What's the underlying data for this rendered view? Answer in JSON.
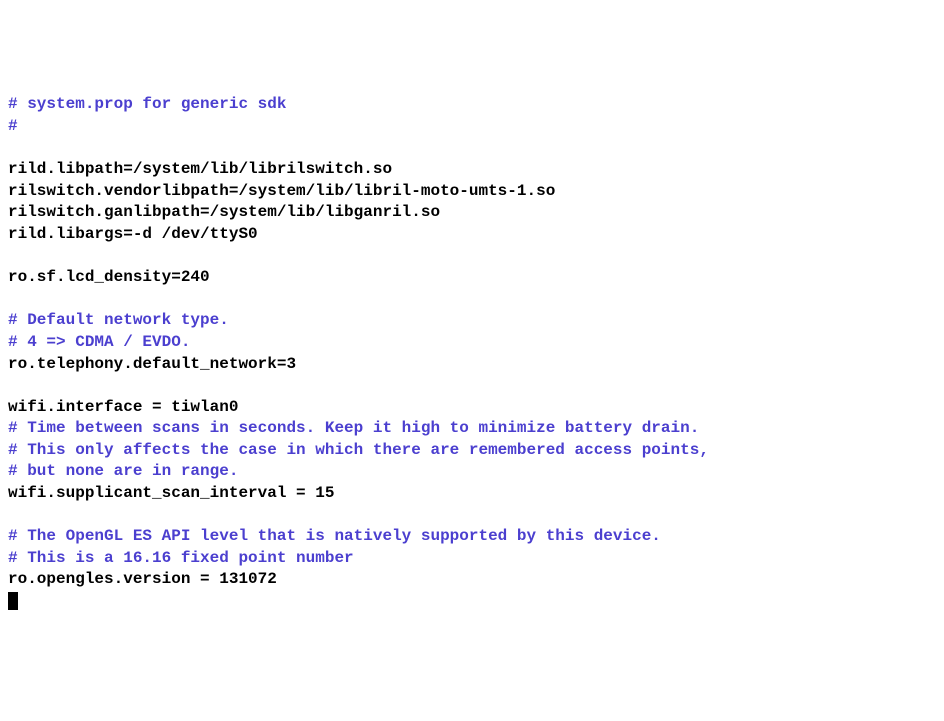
{
  "lines": [
    {
      "text": "# system.prop for generic sdk",
      "type": "comment"
    },
    {
      "text": "#",
      "type": "comment"
    },
    {
      "text": "",
      "type": "normal"
    },
    {
      "text": "rild.libpath=/system/lib/librilswitch.so",
      "type": "normal"
    },
    {
      "text": "rilswitch.vendorlibpath=/system/lib/libril-moto-umts-1.so",
      "type": "normal"
    },
    {
      "text": "rilswitch.ganlibpath=/system/lib/libganril.so",
      "type": "normal"
    },
    {
      "text": "rild.libargs=-d /dev/ttyS0",
      "type": "normal"
    },
    {
      "text": "",
      "type": "normal"
    },
    {
      "text": "ro.sf.lcd_density=240",
      "type": "normal"
    },
    {
      "text": "",
      "type": "normal"
    },
    {
      "text": "# Default network type.",
      "type": "comment"
    },
    {
      "text": "# 4 => CDMA / EVDO.",
      "type": "comment"
    },
    {
      "text": "ro.telephony.default_network=3",
      "type": "normal"
    },
    {
      "text": "",
      "type": "normal"
    },
    {
      "text": "wifi.interface = tiwlan0",
      "type": "normal"
    },
    {
      "text": "# Time between scans in seconds. Keep it high to minimize battery drain.",
      "type": "comment"
    },
    {
      "text": "# This only affects the case in which there are remembered access points,",
      "type": "comment"
    },
    {
      "text": "# but none are in range.",
      "type": "comment"
    },
    {
      "text": "wifi.supplicant_scan_interval = 15",
      "type": "normal"
    },
    {
      "text": "",
      "type": "normal"
    },
    {
      "text": "# The OpenGL ES API level that is natively supported by this device.",
      "type": "comment"
    },
    {
      "text": "# This is a 16.16 fixed point number",
      "type": "comment"
    },
    {
      "text": "ro.opengles.version = 131072",
      "type": "normal"
    }
  ]
}
